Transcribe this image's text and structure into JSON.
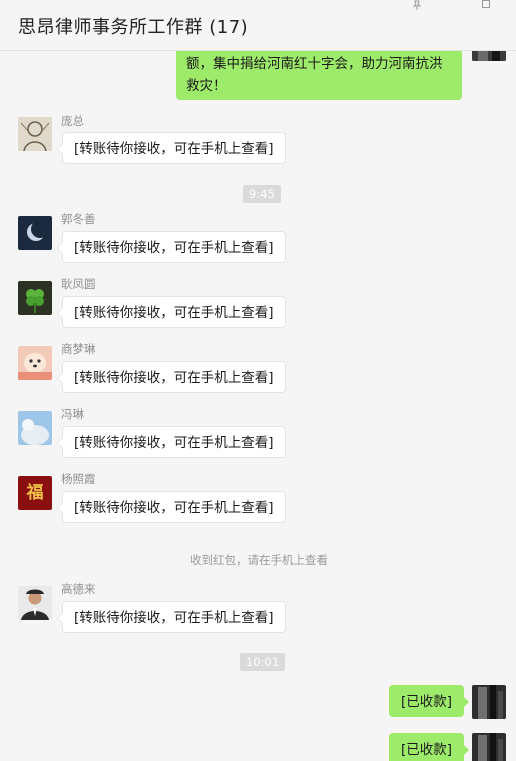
{
  "window": {
    "title": "思昂律师事务所工作群 (17)"
  },
  "colors": {
    "bubble_self": "#9eea6a",
    "bubble_other": "#ffffff",
    "background": "#f5f5f5"
  },
  "icons": {
    "pin": "pin-icon",
    "maximize": "maximize-icon"
  },
  "messages": {
    "top_partial_line1": "额，集中捐给河南红十字会，助力河南抗洪",
    "top_partial_line2": "救灾！",
    "pang": {
      "sender": "庞总",
      "text": "[转账待你接收，可在手机上查看]"
    },
    "time1": "9:45",
    "guo": {
      "sender": "郭冬善",
      "text": "[转账待你接收，可在手机上查看]"
    },
    "geng": {
      "sender": "耿凤圆",
      "text": "[转账待你接收，可在手机上查看]"
    },
    "shang": {
      "sender": "商梦琳",
      "text": "[转账待你接收，可在手机上查看]"
    },
    "feng": {
      "sender": "冯琳",
      "text": "[转账待你接收，可在手机上查看]"
    },
    "yang": {
      "sender": "杨照霞",
      "text": "[转账待你接收，可在手机上查看]",
      "avatar_glyph": "福"
    },
    "sys_redpacket": "收到红包，请在手机上查看",
    "gao": {
      "sender": "高德来",
      "text": "[转账待你接收，可在手机上查看]"
    },
    "time2": "10:01",
    "self1": "[已收款]",
    "self2": "[已收款]"
  }
}
